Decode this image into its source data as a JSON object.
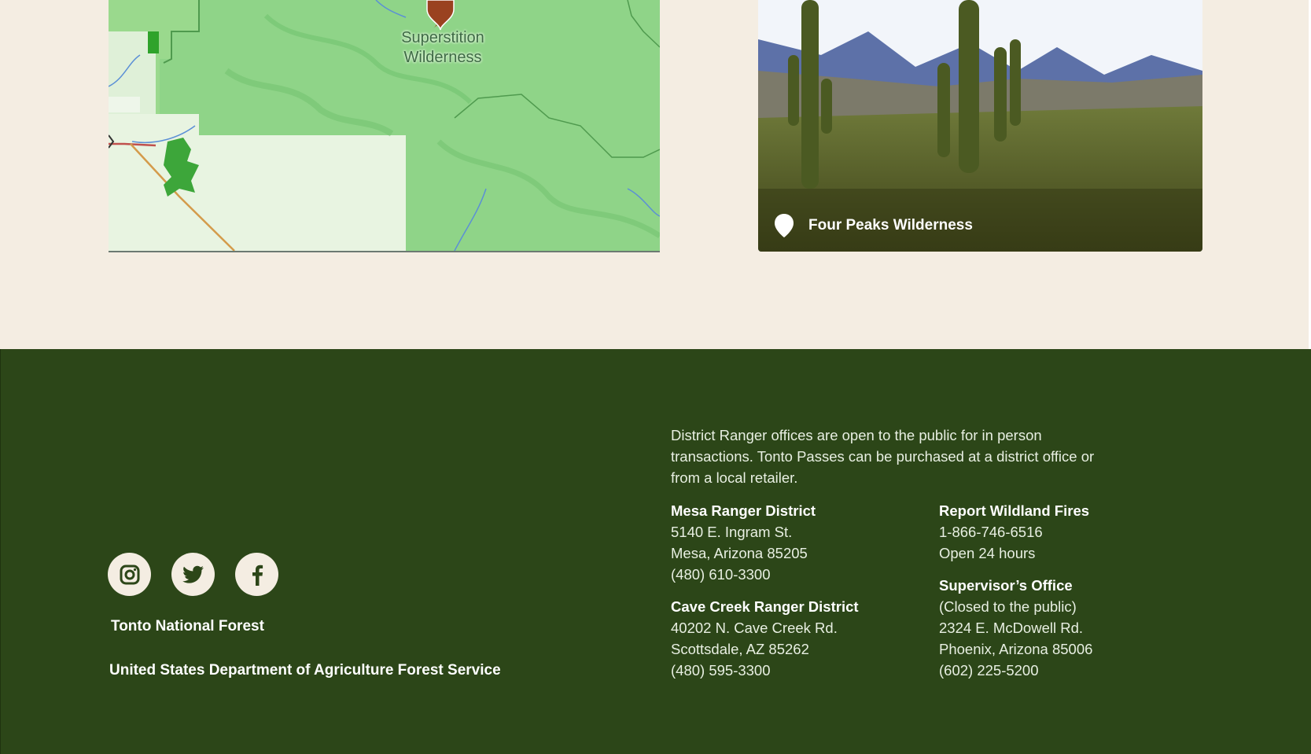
{
  "map_card": {
    "pin_label": "Superstition Wilderness",
    "pin_color": "#9a4220"
  },
  "photo_card": {
    "caption": "Four Peaks Wilderness",
    "pin_icon": "map-pin-icon"
  },
  "footer": {
    "background": "#2c4618",
    "social": [
      {
        "name": "instagram",
        "icon": "instagram-icon"
      },
      {
        "name": "twitter",
        "icon": "twitter-icon"
      },
      {
        "name": "facebook",
        "icon": "facebook-icon"
      }
    ],
    "forest_name": "Tonto National Forest",
    "agency_name": "United States Department of Agriculture Forest Service",
    "notice": "District Ranger offices are open to the public for in person transactions. Tonto Passes can be purchased at a district office or from a local retailer.",
    "mesa": {
      "title": "Mesa Ranger District",
      "lines": [
        "5140 E. Ingram St.",
        "Mesa, Arizona 85205",
        "(480) 610-3300"
      ]
    },
    "cave_creek": {
      "title": "Cave Creek Ranger District",
      "lines": [
        "40202 N. Cave Creek Rd.",
        "Scottsdale, AZ 85262",
        "(480) 595-3300"
      ]
    },
    "wildfires": {
      "title": "Report Wildland Fires",
      "lines": [
        "1-866-746-6516",
        "Open 24 hours"
      ]
    },
    "supervisor": {
      "title": "Supervisor’s Office",
      "lines": [
        "(Closed to the public)",
        "2324 E. McDowell Rd.",
        "Phoenix, Arizona 85006",
        "(602) 225-5200"
      ]
    }
  }
}
